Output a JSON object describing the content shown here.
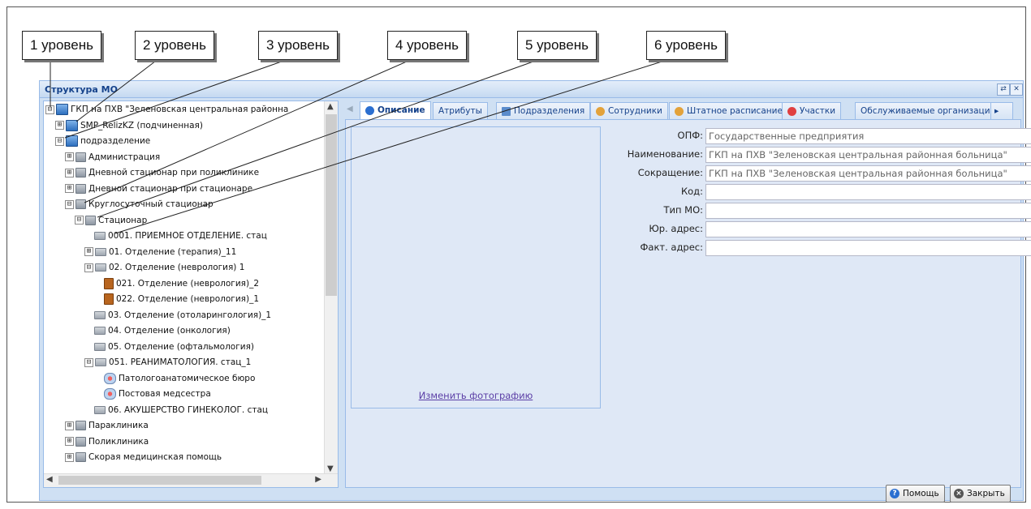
{
  "callouts": [
    "1 уровень",
    "2 уровень",
    "3 уровень",
    "4 уровень",
    "5 уровень",
    "6 уровень"
  ],
  "window": {
    "title": "Структура МО"
  },
  "tree": [
    {
      "label": "ГКП на ПХВ \"Зеленовская центральная районна",
      "toggle": "⊟",
      "icon": "building-blue-icon"
    },
    {
      "label": "SMP_RelizKZ (подчиненная)",
      "toggle": "⊞",
      "icon": "building-blue-icon"
    },
    {
      "label": "подразделение",
      "toggle": "⊟",
      "icon": "building-blue-icon"
    },
    {
      "label": "Администрация",
      "toggle": "⊞",
      "icon": "building-icon"
    },
    {
      "label": "Дневной стационар при поликлинике",
      "toggle": "⊞",
      "icon": "building-icon"
    },
    {
      "label": "Дневной стационар при стационаре",
      "toggle": "⊞",
      "icon": "building-icon"
    },
    {
      "label": "Круглосуточный стационар",
      "toggle": "⊟",
      "icon": "building-icon"
    },
    {
      "label": "Стационар",
      "toggle": "⊟",
      "icon": "building-icon"
    },
    {
      "label": "0001. ПРИЕМНОЕ ОТДЕЛЕНИЕ. стац",
      "toggle": "",
      "icon": "bed-icon"
    },
    {
      "label": "01. Отделение (терапия)_11",
      "toggle": "⊞",
      "icon": "bed-icon"
    },
    {
      "label": "02. Отделение (неврология) 1",
      "toggle": "⊟",
      "icon": "bed-icon"
    },
    {
      "label": "021. Отделение (неврология)_2",
      "toggle": "",
      "icon": "room-icon"
    },
    {
      "label": "022. Отделение (неврология)_1",
      "toggle": "",
      "icon": "room-icon"
    },
    {
      "label": "03. Отделение (отоларингология)_1",
      "toggle": "",
      "icon": "bed-icon"
    },
    {
      "label": "04. Отделение (онкология)",
      "toggle": "",
      "icon": "bed-icon"
    },
    {
      "label": "05. Отделение (офтальмология)",
      "toggle": "",
      "icon": "bed-icon"
    },
    {
      "label": "051. РЕАНИМАТОЛОГИЯ. стац_1",
      "toggle": "⊟",
      "icon": "bed-icon"
    },
    {
      "label": "Патологоанатомическое бюро",
      "toggle": "",
      "icon": "nurse-icon"
    },
    {
      "label": "Постовая медсестра",
      "toggle": "",
      "icon": "nurse-icon"
    },
    {
      "label": "06. АКУШЕРСТВО ГИНЕКОЛОГ. стац",
      "toggle": "",
      "icon": "bed-icon"
    },
    {
      "label": "Параклиника",
      "toggle": "⊞",
      "icon": "building-icon"
    },
    {
      "label": "Поликлиника",
      "toggle": "⊞",
      "icon": "building-icon"
    },
    {
      "label": "Скорая медицинская помощь",
      "toggle": "⊞",
      "icon": "building-icon"
    }
  ],
  "tabs": [
    {
      "label": "Описание",
      "active": true
    },
    {
      "label": "Атрибуты"
    },
    {
      "label": "Подразделения"
    },
    {
      "label": "Сотрудники"
    },
    {
      "label": "Штатное расписание"
    },
    {
      "label": "Участки"
    },
    {
      "label": "Обслуживаемые организации"
    }
  ],
  "photo_link": "Изменить фотографию",
  "fields": [
    {
      "label": "ОПФ:",
      "value": "Государственные предприятия"
    },
    {
      "label": "Наименование:",
      "value": "ГКП на ПХВ \"Зеленовская центральная районная больница\""
    },
    {
      "label": "Сокращение:",
      "value": "ГКП на ПХВ \"Зеленовская центральная районная больница\""
    },
    {
      "label": "Код:",
      "value": ""
    },
    {
      "label": "Тип МО:",
      "value": ""
    },
    {
      "label": "Юр. адрес:",
      "value": ""
    },
    {
      "label": "Факт. адрес:",
      "value": ""
    }
  ],
  "buttons": {
    "help": "Помощь",
    "close": "Закрыть"
  },
  "colors": {
    "accent": "#15428b",
    "border": "#99bbe8",
    "panel": "#dfe8f6"
  }
}
